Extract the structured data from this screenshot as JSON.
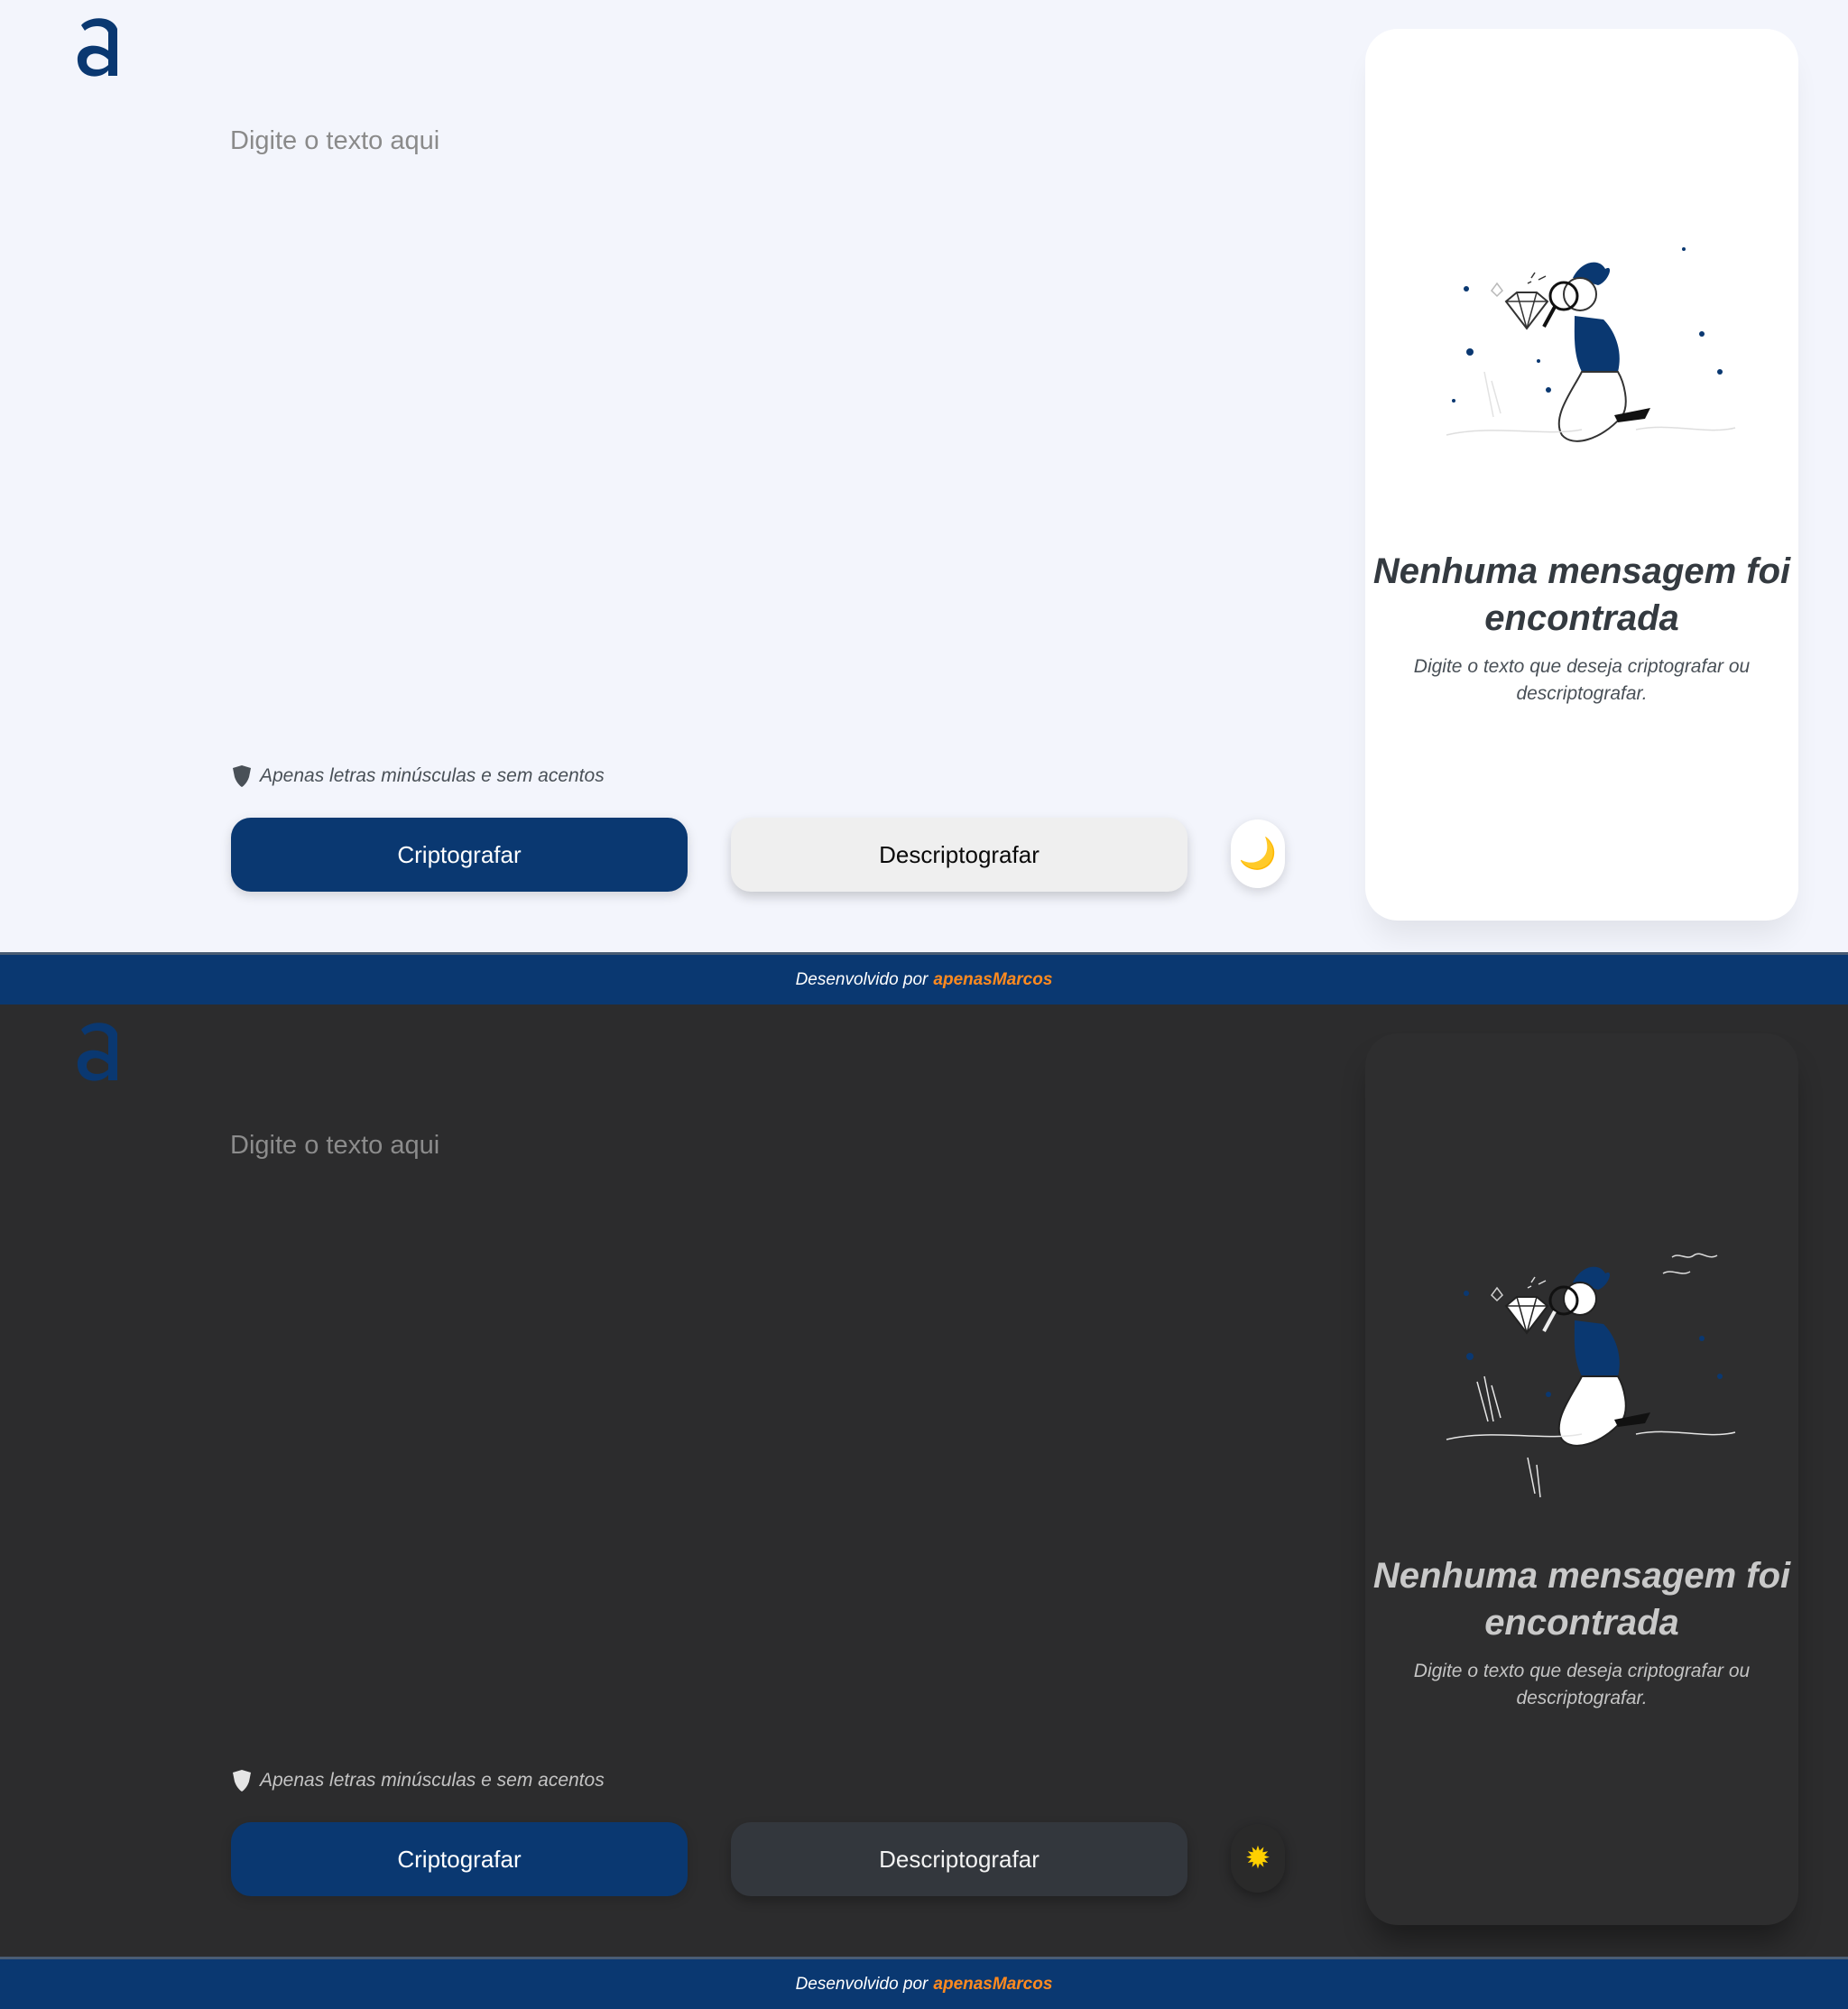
{
  "brand": {
    "logo_icon": "alura-a-logo-icon",
    "accent_color": "#0a3871",
    "author_color": "#ff8a1f"
  },
  "light_view": {
    "input": {
      "placeholder": "Digite o texto aqui",
      "value": ""
    },
    "hint": {
      "icon": "info-shield-icon",
      "text": "Apenas letras minúsculas e sem acentos"
    },
    "buttons": {
      "encrypt": "Criptografar",
      "decrypt": "Descriptografar"
    },
    "theme_toggle": {
      "icon": "moon-icon",
      "glyph": "🌙"
    },
    "output_card": {
      "illustration": "person-with-magnifier-illustration",
      "title": "Nenhuma mensagem foi encontrada",
      "text": "Digite o texto que deseja criptografar ou descriptografar."
    },
    "footer": {
      "prefix": "Desenvolvido por",
      "author": "apenasMarcos"
    },
    "background": "#f3f5fc"
  },
  "dark_view": {
    "input": {
      "placeholder": "Digite o texto aqui",
      "value": ""
    },
    "hint": {
      "icon": "info-shield-icon",
      "text": "Apenas letras minúsculas e sem acentos"
    },
    "buttons": {
      "encrypt": "Criptografar",
      "decrypt": "Descriptografar"
    },
    "theme_toggle": {
      "icon": "sun-icon",
      "glyph": "✹"
    },
    "output_card": {
      "illustration": "person-with-magnifier-illustration",
      "title": "Nenhuma mensagem foi encontrada",
      "text": "Digite o texto que deseja criptografar ou descriptografar."
    },
    "footer": {
      "prefix": "Desenvolvido por",
      "author": "apenasMarcos"
    },
    "background": "#2c2c2d"
  }
}
